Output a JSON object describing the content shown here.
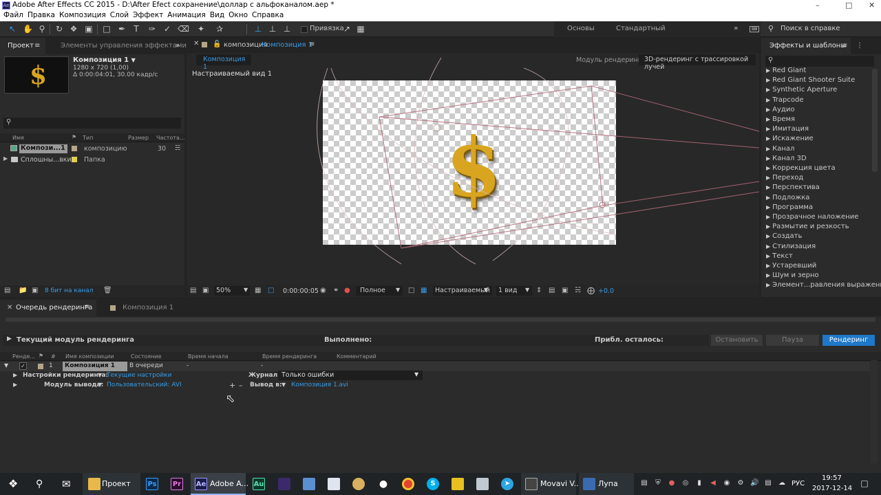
{
  "window": {
    "title": "Adobe After Effects CC 2015 - D:\\After Efect сохранение\\доллар с альфоканалом.aep *",
    "app_icon": "Ae"
  },
  "menu": [
    "Файл",
    "Правка",
    "Композиция",
    "Слой",
    "Эффект",
    "Анимация",
    "Вид",
    "Окно",
    "Справка"
  ],
  "toolbar": {
    "snap_label": "Привязка",
    "workspace_basic": "Основы",
    "workspace_standard": "Стандартный",
    "help_search": "Поиск в справке"
  },
  "project_panel": {
    "tab_project": "Проект",
    "tab_effects_controls": "Элементы управления эффектами",
    "thumb_glyph": "$",
    "comp_name": "Композиция 1",
    "comp_info1": "1280 x 720 (1,00)",
    "comp_info2": "Δ 0:00:04:01, 30.00 кадр/с",
    "columns": {
      "name": "Имя",
      "type": "Тип",
      "size": "Размер",
      "fps": "Частота..."
    },
    "items": [
      {
        "name": "Компози...1",
        "type": "композицию",
        "fps": "30"
      },
      {
        "name": "Сплошны...вки",
        "type": "Папка",
        "fps": ""
      }
    ],
    "bit_depth": "8 бит на канал"
  },
  "composition_panel": {
    "tab_prefix": "композиция",
    "tab_name": "Композиция 1",
    "subtab": "Композиция 1",
    "renderer_label": "Модуль рендеринга:",
    "renderer_value": "3D-рендеринг с трассировкой лучей",
    "view_label": "Настраиваемый вид 1",
    "zoom": "50%",
    "timecode": "0:00:00:05",
    "resolution": "Полное",
    "view_mode": "Настраиваемый",
    "views": "1 вид",
    "exposure": "+0.0",
    "content_glyph": "$"
  },
  "effects_panel": {
    "title": "Эффекты и шаблоны",
    "items": [
      "Red Giant",
      "Red Giant Shooter Suite",
      "Synthetic Aperture",
      "Trapcode",
      "Аудио",
      "Время",
      "Имитация",
      "Искажение",
      "Канал",
      "Канал 3D",
      "Коррекция цвета",
      "Переход",
      "Перспектива",
      "Подложка",
      "Программа",
      "Прозрачное наложение",
      "Размытие и резкость",
      "Создать",
      "Стилизация",
      "Текст",
      "Устаревший",
      "Шум и зерно",
      "Элемент...равления выражения"
    ]
  },
  "render_queue": {
    "tab_label": "Очередь рендеринга",
    "tab_comp": "Композиция 1",
    "current_module": "Текущий модуль рендеринга",
    "completed": "Выполнено:",
    "remaining": "Прибл. осталось:",
    "btn_stop": "Остановить",
    "btn_pause": "Пауза",
    "btn_render": "Рендеринг",
    "columns": {
      "render": "Ренде...",
      "num": "#",
      "comp_name": "Имя композиции",
      "status": "Состояние",
      "start_time": "Время начала",
      "render_time": "Время рендеринга",
      "comment": "Комментарий"
    },
    "row": {
      "num": "1",
      "comp_name": "Композиция 1",
      "status": "В очереди",
      "start_time": "-",
      "render_time": "-"
    },
    "render_settings_label": "Настройки рендеринга:",
    "render_settings_value": "Текущие настройки",
    "log_label": "Журнал:",
    "log_value": "Только ошибки",
    "output_module_label": "Модуль вывода:",
    "output_module_value": "Пользовательский: AVI",
    "output_to_label": "Вывод в:",
    "output_to_value": "Композиция 1.avi"
  },
  "taskbar": {
    "items": [
      {
        "label": "Проект",
        "icon": "folder-icon"
      },
      {
        "label": "Adobe A...",
        "icon": "after-effects-icon"
      },
      {
        "label": "Movavi V...",
        "icon": "movavi-icon"
      },
      {
        "label": "Лупа",
        "icon": "magnifier-icon"
      }
    ],
    "lang": "РУС",
    "time": "19:57",
    "date": "2017-12-14",
    "app_labels": {
      "ps": "Ps",
      "pr": "Pr",
      "ae": "Ae",
      "au": "Au"
    }
  },
  "colors": {
    "accent_blue": "#2d8ceb",
    "render_button": "#1f78c8",
    "panel_bg": "#2b2b2b",
    "gold": "#d9a520"
  }
}
